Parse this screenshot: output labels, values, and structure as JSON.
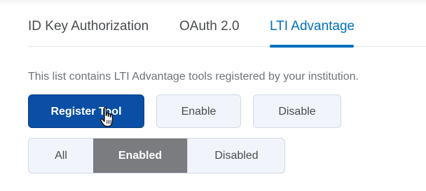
{
  "tabs": [
    {
      "label": "ID Key Authorization",
      "selected": false
    },
    {
      "label": "OAuth 2.0",
      "selected": false
    },
    {
      "label": "LTI Advantage",
      "selected": true
    }
  ],
  "description": "This list contains LTI Advantage tools registered by your institution.",
  "actions": {
    "register_label": "Register Tool",
    "enable_label": "Enable",
    "disable_label": "Disable"
  },
  "filter": {
    "options": [
      "All",
      "Enabled",
      "Disabled"
    ],
    "selected": "Enabled"
  },
  "colors": {
    "accent": "#006fbf",
    "primary_button": "#0a4fa5",
    "selected_filter": "#7a7c80"
  },
  "icons": {
    "cursor": "hand-pointer-icon"
  }
}
